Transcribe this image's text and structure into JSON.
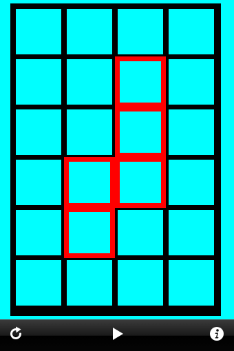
{
  "board": {
    "rows": 6,
    "cols": 4,
    "cell_color": "#00ffff",
    "grid_color": "#000000",
    "highlight_color": "#ff0000",
    "highlighted_cells": [
      {
        "row": 1,
        "col": 2
      },
      {
        "row": 2,
        "col": 2
      },
      {
        "row": 3,
        "col": 1
      },
      {
        "row": 3,
        "col": 2
      },
      {
        "row": 4,
        "col": 1
      }
    ]
  },
  "toolbar": {
    "buttons": [
      {
        "name": "restart-button",
        "icon": "refresh-icon"
      },
      {
        "name": "play-button",
        "icon": "play-icon"
      },
      {
        "name": "info-button",
        "icon": "info-icon"
      }
    ]
  }
}
